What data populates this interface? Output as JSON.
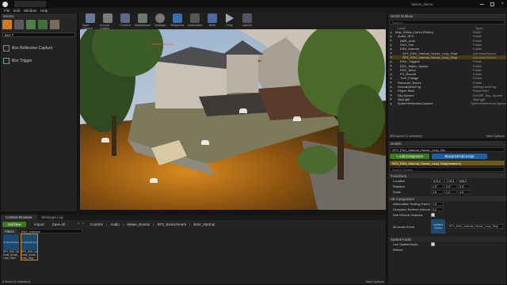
{
  "window": {
    "menus": [
      "File",
      "Edit",
      "Window",
      "Help"
    ],
    "project_title": "Weise_Demo"
  },
  "modes": {
    "title": "Modes",
    "search_value": "Box T",
    "results": [
      {
        "label": "Box Reflection Capture"
      },
      {
        "label": "Box Trigger"
      }
    ]
  },
  "toolbar": {
    "buttons": [
      "Save Current",
      "Source Control",
      "Content",
      "Marketplace",
      "Settings",
      "Blueprints",
      "Cinematics",
      "Build",
      "Play",
      "Launch"
    ]
  },
  "viewport": {
    "warning_text": "...default objects)"
  },
  "outliner": {
    "title": "World Outliner",
    "search_placeholder": "Search...",
    "col_label": "Label",
    "col_type": "Type",
    "rows": [
      {
        "label": "Map_Weise_Demo (Editor)",
        "type": "World"
      },
      {
        "label": "Audio_SFX",
        "type": "Folder"
      },
      {
        "label": "AMB_Amb",
        "type": "Folder"
      },
      {
        "label": "ENV_Fire",
        "type": "Folder"
      },
      {
        "label": "ENV_Internal",
        "type": "Folder"
      },
      {
        "label": "SFX_ENV_Internal_House_Loop_Start",
        "type": "AAmbientSound"
      },
      {
        "label": "SFX_ENV_Internal_House_Loop_Stop",
        "type": "AAmbientSound"
      },
      {
        "label": "ENV_Triggers",
        "type": "Folder"
      },
      {
        "label": "ENV_Water_Splash",
        "type": "Folder"
      },
      {
        "label": "ENV_Wind",
        "type": "Folder"
      },
      {
        "label": "FX_Reverb",
        "type": "Folder"
      },
      {
        "label": "Tree_Foliage",
        "type": "Folder"
      },
      {
        "label": "Structure_Boxes",
        "type": "Folder"
      },
      {
        "label": "AtmosphericFog",
        "type": "AtmosphericFog"
      },
      {
        "label": "Player Start",
        "type": "PlayerStart"
      },
      {
        "label": "Sky Sphere",
        "type": "Edit BP_Sky_Sphere"
      },
      {
        "label": "SkyLight",
        "type": "SkyLight"
      },
      {
        "label": "SphereReflectionCapture",
        "type": "SphereReflectionCapture"
      }
    ],
    "footer": "565 actors (1 selected)",
    "view_options": "View Options"
  },
  "details": {
    "name_value": "SFX_ENV_Internal_House_Loop_Sto",
    "add_component": "+ Add Component",
    "blueprint_btn": "Blueprint/Add Script",
    "component_row": "SFX_ENV_Internal_House_Loop_Stop(Instance)",
    "search_placeholder": "Search Details",
    "transform_header": "Transform",
    "location_label": "Location",
    "location": [
      "-570.5",
      "-178.5",
      "608.0"
    ],
    "rotation_label": "Rotation",
    "rotation": [
      "0.0°",
      "0.0°",
      "0.0°"
    ],
    "scale_label": "Scale",
    "scale": [
      "1.0",
      "1.0",
      "1.0"
    ],
    "sound_header": "Ak Component",
    "attenuation_label": "Attenuation Scaling Factor",
    "attenuation_value": "1.0",
    "occlusion_label": "Occlusion Refresh Interval",
    "occlusion_value": "0.2",
    "use_reverb_label": "Use Reverb Volumes",
    "audio_event_label": "Ak Audio Event",
    "audio_event_value": "SFX_ENV_Internal_House_Loop_Stop",
    "thumb_label": "Ambient Sound",
    "spatial_header": "Spatial Audio",
    "use_spatial_label": "Use Spatial Audio",
    "reflect_label": "Reflect"
  },
  "content_browser": {
    "tab1": "Content Browser",
    "tab2": "Message Log",
    "add_new": "Add New",
    "import": "Import",
    "save_all": "Save All",
    "path": [
      "Content",
      "Audio",
      "Weise_Events",
      "SFX_Environment",
      "ENV_Internal"
    ],
    "filters": "Filters",
    "search_value": "ENV_Internal",
    "assets": [
      {
        "thumb": "AmbientSound",
        "name": "SFX_ENV_Internal_House_Loop_Start"
      },
      {
        "thumb": "AmbientSound",
        "name": "SFX_ENV_Internal_House_Loop_Stop"
      }
    ],
    "footer": "2 items (1 selected)",
    "view_options": "View Options"
  }
}
